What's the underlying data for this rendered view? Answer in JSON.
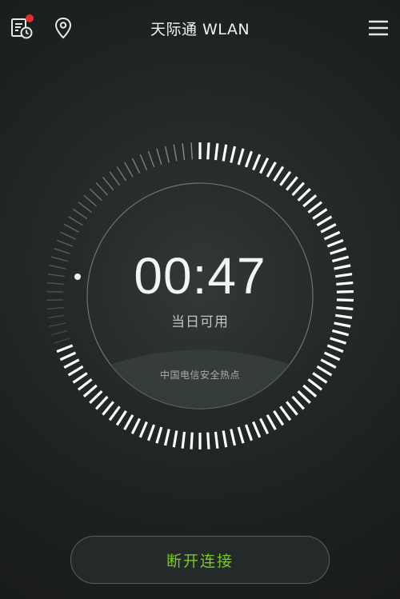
{
  "header": {
    "title": "天际通 WLAN",
    "history_icon": "history-clock-icon",
    "location_icon": "location-pin-icon",
    "menu_icon": "hamburger-menu-icon",
    "notification_color": "#e0302a"
  },
  "dial": {
    "time_remaining": "00:47",
    "caption": "当日可用",
    "hotspot_name": "中国电信安全热点"
  },
  "actions": {
    "disconnect_label": "断开连接",
    "accent_color": "#7cc432"
  }
}
